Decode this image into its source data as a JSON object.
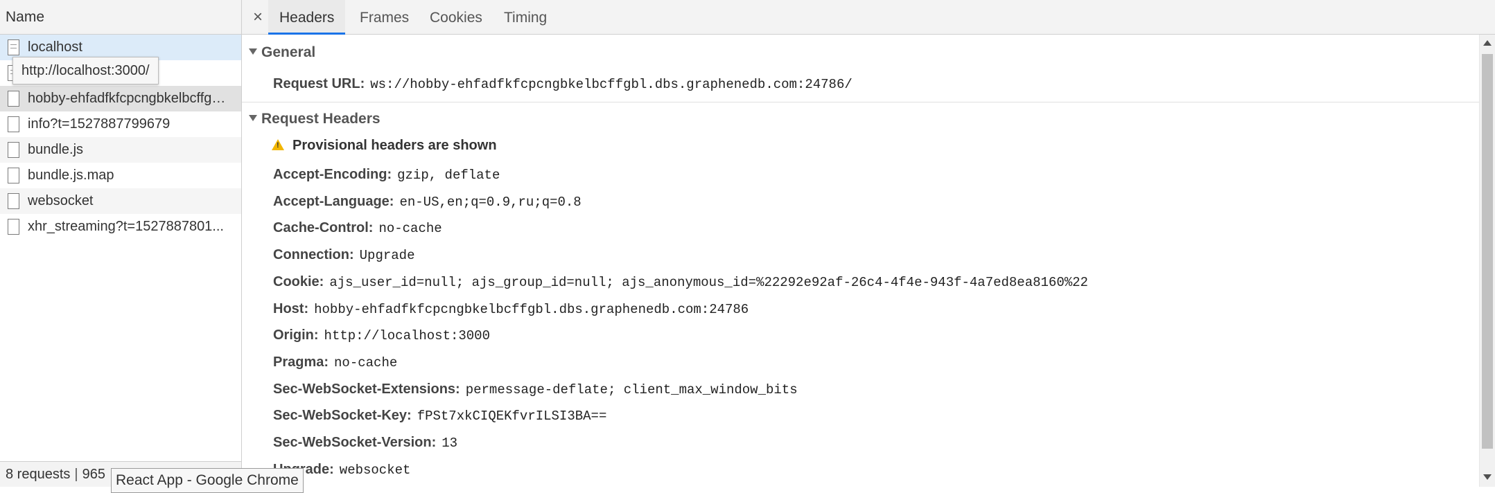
{
  "left": {
    "name_header": "Name",
    "requests": [
      {
        "name": "localhost",
        "icon": "document-icon"
      },
      {
        "name": "",
        "icon": "document-icon"
      },
      {
        "name": "hobby-ehfadfkfcpcngbkelbcffgbl.dbs.graphenedb.com",
        "icon": "document-icon"
      },
      {
        "name": "info?t=1527887799679",
        "icon": "document-icon"
      },
      {
        "name": "bundle.js",
        "icon": "document-icon"
      },
      {
        "name": "bundle.js.map",
        "icon": "document-icon"
      },
      {
        "name": "websocket",
        "icon": "document-icon"
      },
      {
        "name": "xhr_streaming?t=1527887801...",
        "icon": "document-icon"
      }
    ],
    "url_tooltip": "http://localhost:3000/",
    "status": {
      "requests": "8 requests",
      "separator": "|",
      "transferred": "965"
    },
    "window_tooltip": "React App - Google Chrome"
  },
  "tabs": {
    "close": "×",
    "items": [
      "Headers",
      "Frames",
      "Cookies",
      "Timing"
    ],
    "active": "Headers"
  },
  "general": {
    "title": "General",
    "request_url_label": "Request URL:",
    "request_url_value": "ws://hobby-ehfadfkfcpcngbkelbcffgbl.dbs.graphenedb.com:24786/"
  },
  "request_headers": {
    "title": "Request Headers",
    "warning": "Provisional headers are shown",
    "rows": [
      {
        "name": "Accept-Encoding:",
        "value": "gzip, deflate"
      },
      {
        "name": "Accept-Language:",
        "value": "en-US,en;q=0.9,ru;q=0.8"
      },
      {
        "name": "Cache-Control:",
        "value": "no-cache"
      },
      {
        "name": "Connection:",
        "value": "Upgrade"
      },
      {
        "name": "Cookie:",
        "value": "ajs_user_id=null; ajs_group_id=null; ajs_anonymous_id=%22292e92af-26c4-4f4e-943f-4a7ed8ea8160%22"
      },
      {
        "name": "Host:",
        "value": "hobby-ehfadfkfcpcngbkelbcffgbl.dbs.graphenedb.com:24786"
      },
      {
        "name": "Origin:",
        "value": "http://localhost:3000"
      },
      {
        "name": "Pragma:",
        "value": "no-cache"
      },
      {
        "name": "Sec-WebSocket-Extensions:",
        "value": "permessage-deflate; client_max_window_bits"
      },
      {
        "name": "Sec-WebSocket-Key:",
        "value": "fPSt7xkCIQEKfvrILSI3BA=="
      },
      {
        "name": "Sec-WebSocket-Version:",
        "value": "13"
      },
      {
        "name": "Upgrade:",
        "value": "websocket"
      }
    ]
  },
  "colors": {
    "accent": "#1a73e8",
    "selected_row": "#dcebf9",
    "warning": "#f2b600"
  }
}
